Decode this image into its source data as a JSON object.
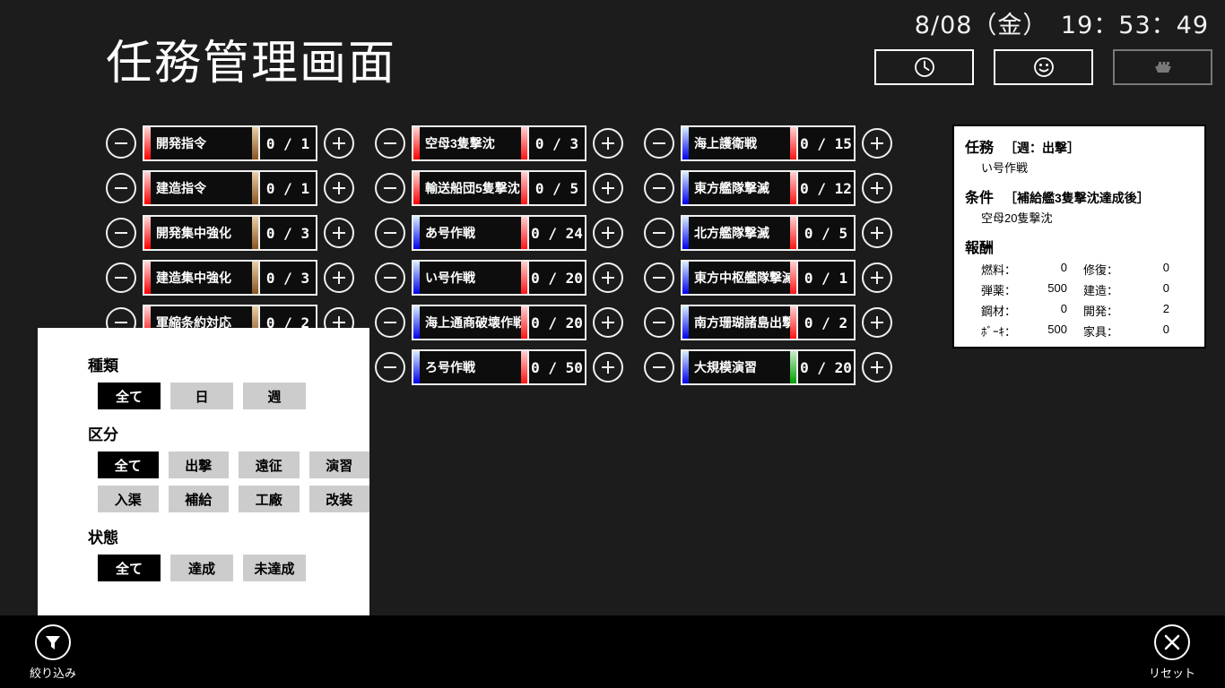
{
  "header": {
    "clock": "8/08（金）　19：53：49",
    "title": "任務管理画面",
    "mode_buttons": [
      {
        "name": "clock-mode-button",
        "icon": "clock-icon",
        "disabled": false
      },
      {
        "name": "face-mode-button",
        "icon": "smiley-icon",
        "disabled": false
      },
      {
        "name": "ship-mode-button",
        "icon": "ship-icon",
        "disabled": true
      }
    ]
  },
  "colors": {
    "background": "#1c1c1c",
    "card_background": "#0d0d0d",
    "outline": "#f0f0f0",
    "panel_background": "#ffffff",
    "panel_text": "#000000",
    "bottom_bar": "#000000",
    "selected_button": "#000000",
    "unselected_button": "#cccccc",
    "cat_red_top": "#ffd6d6",
    "cat_red_bottom": "#ff0000",
    "cat_blue_top": "#d6ecff",
    "cat_blue_bottom": "#0000ee",
    "prog_brown_top": "#e8cfa8",
    "prog_brown_bottom": "#8a5520",
    "prog_red_top": "#ffd0d0",
    "prog_red_bottom": "#ff1414",
    "prog_green_top": "#c8f0c8",
    "prog_green_bottom": "#00a000"
  },
  "columns": [
    {
      "name": "task-column-1",
      "rows": [
        {
          "title": "開発指令",
          "current": "0",
          "max": "1",
          "cat": "red",
          "prog": "brown"
        },
        {
          "title": "建造指令",
          "current": "0",
          "max": "1",
          "cat": "red",
          "prog": "brown"
        },
        {
          "title": "開発集中強化",
          "current": "0",
          "max": "3",
          "cat": "red",
          "prog": "brown"
        },
        {
          "title": "建造集中強化",
          "current": "0",
          "max": "3",
          "cat": "red",
          "prog": "brown"
        },
        {
          "title": "軍縮条約対応",
          "current": "0",
          "max": "2",
          "cat": "red",
          "prog": "brown"
        },
        {
          "title": "",
          "current": "",
          "max": "",
          "cat": "none",
          "prog": "none"
        },
        {
          "title": "",
          "current": "",
          "max": "",
          "cat": "none",
          "prog": "none"
        }
      ]
    },
    {
      "name": "task-column-2",
      "rows": [
        {
          "title": "空母3隻撃沈",
          "current": "0",
          "max": "3",
          "cat": "red",
          "prog": "red"
        },
        {
          "title": "輸送船団5隻撃沈",
          "current": "0",
          "max": "5",
          "cat": "red",
          "prog": "red"
        },
        {
          "title": "あ号作戦",
          "current": "0",
          "max": "24",
          "cat": "blue",
          "prog": "red"
        },
        {
          "title": "い号作戦",
          "current": "0",
          "max": "20",
          "cat": "blue",
          "prog": "red"
        },
        {
          "title": "海上通商破壊作戦",
          "current": "0",
          "max": "20",
          "cat": "blue",
          "prog": "red"
        },
        {
          "title": "ろ号作戦",
          "current": "0",
          "max": "50",
          "cat": "blue",
          "prog": "red"
        }
      ]
    },
    {
      "name": "task-column-3",
      "rows": [
        {
          "title": "海上護衛戦",
          "current": "0",
          "max": "15",
          "cat": "blue",
          "prog": "red"
        },
        {
          "title": "東方艦隊撃滅",
          "current": "0",
          "max": "12",
          "cat": "blue",
          "prog": "red"
        },
        {
          "title": "北方艦隊撃滅",
          "current": "0",
          "max": "5",
          "cat": "blue",
          "prog": "red"
        },
        {
          "title": "東方中枢艦隊撃滅",
          "current": "0",
          "max": "1",
          "cat": "blue",
          "prog": "red"
        },
        {
          "title": "南方珊瑚諸島出撃",
          "current": "0",
          "max": "2",
          "cat": "blue",
          "prog": "red"
        },
        {
          "title": "大規模演習",
          "current": "0",
          "max": "20",
          "cat": "blue",
          "prog": "green"
        }
      ]
    }
  ],
  "detail": {
    "mission_label": "任務",
    "mission_tag": "［週：出撃］",
    "mission_name": "い号作戦",
    "condition_label": "条件",
    "condition_tag": "［補給艦3隻撃沈達成後］",
    "condition_text": "空母20隻撃沈",
    "reward_label": "報酬",
    "rewards": [
      {
        "left_label": "燃料：",
        "left_value": "0",
        "right_label": "修復：",
        "right_value": "0"
      },
      {
        "left_label": "弾薬：",
        "left_value": "500",
        "right_label": "建造：",
        "right_value": "0"
      },
      {
        "left_label": "鋼材：",
        "left_value": "0",
        "right_label": "開発：",
        "right_value": "2"
      },
      {
        "left_label": "ﾎﾞｰｷ：",
        "left_value": "500",
        "right_label": "家具：",
        "right_value": "0"
      }
    ]
  },
  "filter": {
    "groups": [
      {
        "name": "filter-group-type",
        "title": "種類",
        "rows": [
          [
            {
              "label": "全て",
              "selected": true
            },
            {
              "label": "日",
              "selected": false
            },
            {
              "label": "週",
              "selected": false
            }
          ]
        ]
      },
      {
        "name": "filter-group-category",
        "title": "区分",
        "rows": [
          [
            {
              "label": "全て",
              "selected": true
            },
            {
              "label": "出撃",
              "selected": false
            },
            {
              "label": "遠征",
              "selected": false
            },
            {
              "label": "演習",
              "selected": false
            }
          ],
          [
            {
              "label": "入渠",
              "selected": false
            },
            {
              "label": "補給",
              "selected": false
            },
            {
              "label": "工廠",
              "selected": false
            },
            {
              "label": "改装",
              "selected": false
            }
          ]
        ]
      },
      {
        "name": "filter-group-state",
        "title": "状態",
        "rows": [
          [
            {
              "label": "全て",
              "selected": true
            },
            {
              "label": "達成",
              "selected": false
            },
            {
              "label": "未達成",
              "selected": false
            }
          ]
        ]
      }
    ]
  },
  "bottom": {
    "filter_label": "絞り込み",
    "reset_label": "リセット"
  }
}
